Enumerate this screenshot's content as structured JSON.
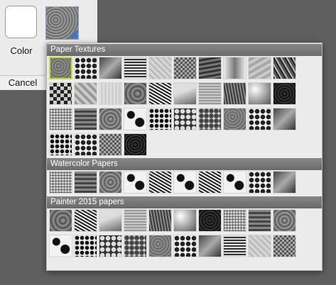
{
  "back_panel": {
    "color_label": "Color",
    "cancel_label": "Cancel"
  },
  "popup": {
    "sections": [
      {
        "title": "Paper Textures",
        "rows": 4,
        "count": 34
      },
      {
        "title": "Watercolor Papers",
        "rows": 1,
        "count": 10
      },
      {
        "title": "Painter 2015 papers",
        "rows": 2,
        "count": 20
      }
    ],
    "selected_index": 0,
    "selection_color": "#c8dc3a"
  },
  "colors": {
    "background": "#5f5f5f",
    "panel": "#ececec",
    "header": "#787878",
    "accent": "#3a74d8"
  }
}
